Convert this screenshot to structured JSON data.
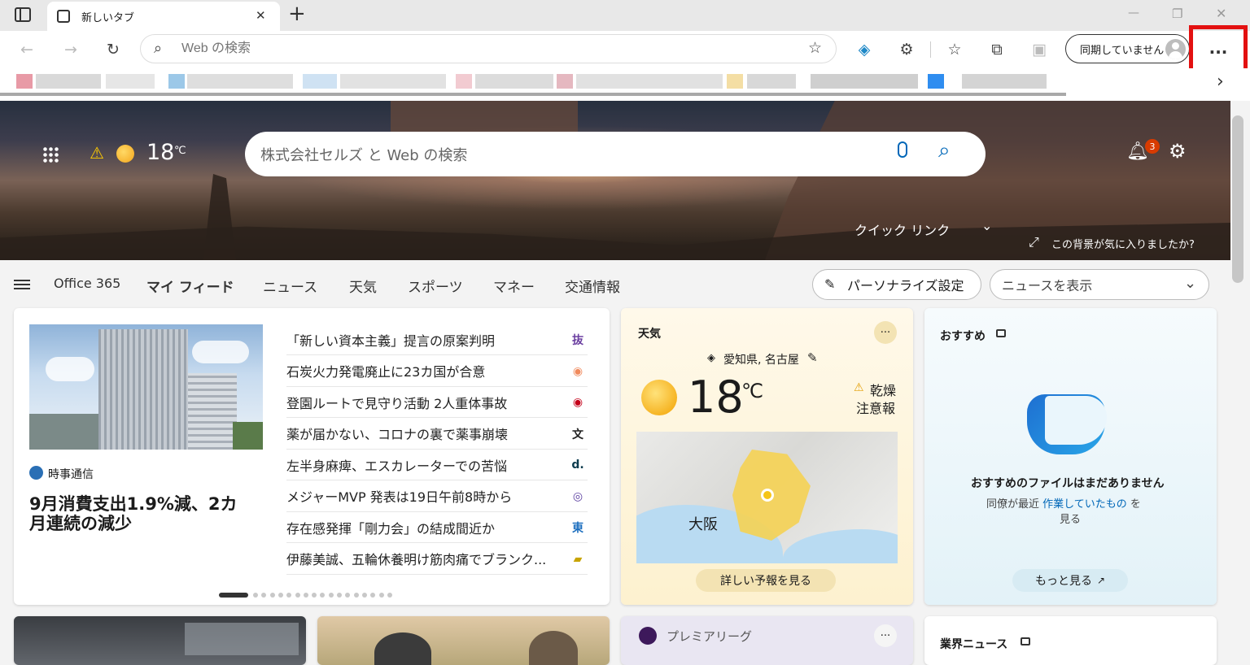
{
  "tab": {
    "title": "新しいタブ",
    "close": "✕",
    "new": "+"
  },
  "window": {
    "minimize": "—",
    "restore": "❐",
    "close": "✕"
  },
  "address": {
    "placeholder": "Web の検索"
  },
  "sync": {
    "label": "同期していません"
  },
  "more_button": "···",
  "favbar_next": "›",
  "hero": {
    "temperature": "18",
    "unit": "℃",
    "search_placeholder": "株式会社セルズ と Web の検索",
    "notifications": "3",
    "quick_links": "クイック リンク",
    "bg_question": "この背景が気に入りましたか?"
  },
  "nav": {
    "items": [
      "Office 365",
      "マイ フィード",
      "ニュース",
      "天気",
      "スポーツ",
      "マネー",
      "交通情報"
    ],
    "personalize": "パーソナライズ設定",
    "news_select": "ニュースを表示"
  },
  "top_story": {
    "source": "時事通信",
    "headline": "9月消費支出1.9%減、2カ月連続の減少"
  },
  "headlines": [
    {
      "text": "「新しい資本主義」提言の原案判明",
      "icon": "抜"
    },
    {
      "text": "石炭火力発電廃止に23カ国が合意",
      "icon": "◉"
    },
    {
      "text": "登園ルートで見守り活動 2人重体事故",
      "icon": "◉"
    },
    {
      "text": "薬が届かない、コロナの裏で薬事崩壊",
      "icon": "文"
    },
    {
      "text": "左半身麻痺、エスカレーターでの苦悩",
      "icon": "d."
    },
    {
      "text": "メジャーMVP 発表は19日午前8時から",
      "icon": "◎"
    },
    {
      "text": "存在感発揮「剛力会」の結成間近か",
      "icon": "東"
    },
    {
      "text": "伊藤美誠、五輪休養明け筋肉痛でブランク...",
      "icon": "▰"
    }
  ],
  "weather": {
    "title": "天気",
    "location": "愛知県, 名古屋",
    "temp": "18",
    "unit": "℃",
    "alert1": "乾燥",
    "alert2": "注意報",
    "map_label": "大阪",
    "forecast": "詳しい予報を見る",
    "menu": "···"
  },
  "recommended": {
    "title": "おすすめ",
    "empty": "おすすめのファイルはまだありません",
    "desc1": "同僚が最近",
    "desc_link": "作業していたもの",
    "desc2": "を",
    "desc3": "見る",
    "more": "もっと見る"
  },
  "premier": {
    "title": "プレミアリーグ",
    "menu": "···"
  },
  "industry": {
    "title": "業界ニュース"
  },
  "colors": {
    "accent": "#0067b8",
    "red_box": "#e31010"
  }
}
